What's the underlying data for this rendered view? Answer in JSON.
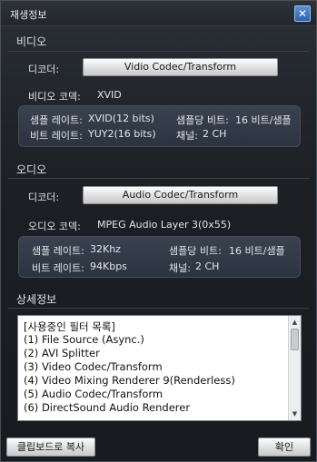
{
  "window": {
    "title": "재생정보",
    "close_icon": "✕"
  },
  "video": {
    "heading": "비디오",
    "decoder_label": "디코더:",
    "decoder_button": "Vidio Codec/Transform",
    "codec_label": "비디오 코덱:",
    "codec_value": "XVID",
    "sample_rate_label": "샘플 레이트:",
    "sample_rate_value": "XVID(12 bits)",
    "bits_per_sample_label": "샘플당 비트:",
    "bits_per_sample_value": "16 비트/샘플",
    "bitrate_label": "비트 레이트:",
    "bitrate_value": "YUY2(16 bits)",
    "channels_label": "채널:",
    "channels_value": "2 CH"
  },
  "audio": {
    "heading": "오디오",
    "decoder_label": "디코더:",
    "decoder_button": "Audio Codec/Transform",
    "codec_label": "오디오 코덱:",
    "codec_value": "MPEG Audio Layer 3(0x55)",
    "sample_rate_label": "샘플 레이트:",
    "sample_rate_value": "32Khz",
    "bits_per_sample_label": "샘플당 비트:",
    "bits_per_sample_value": "16 비트/샘플",
    "bitrate_label": "비트 레이트:",
    "bitrate_value": "94Kbps",
    "channels_label": "채널:",
    "channels_value": "2 CH"
  },
  "details": {
    "heading": "상세정보",
    "lines": [
      "[사용중인 필터 목록]",
      "(1) File Source (Async.)",
      "(2) AVI Splitter",
      "(3) Video Codec/Transform",
      "(4) Video Mixing Renderer 9(Renderless)",
      "(5) Audio Codec/Transform",
      "(6) DirectSound Audio Renderer"
    ]
  },
  "footer": {
    "copy_button": "클립보드로 복사",
    "ok_button": "확인"
  }
}
